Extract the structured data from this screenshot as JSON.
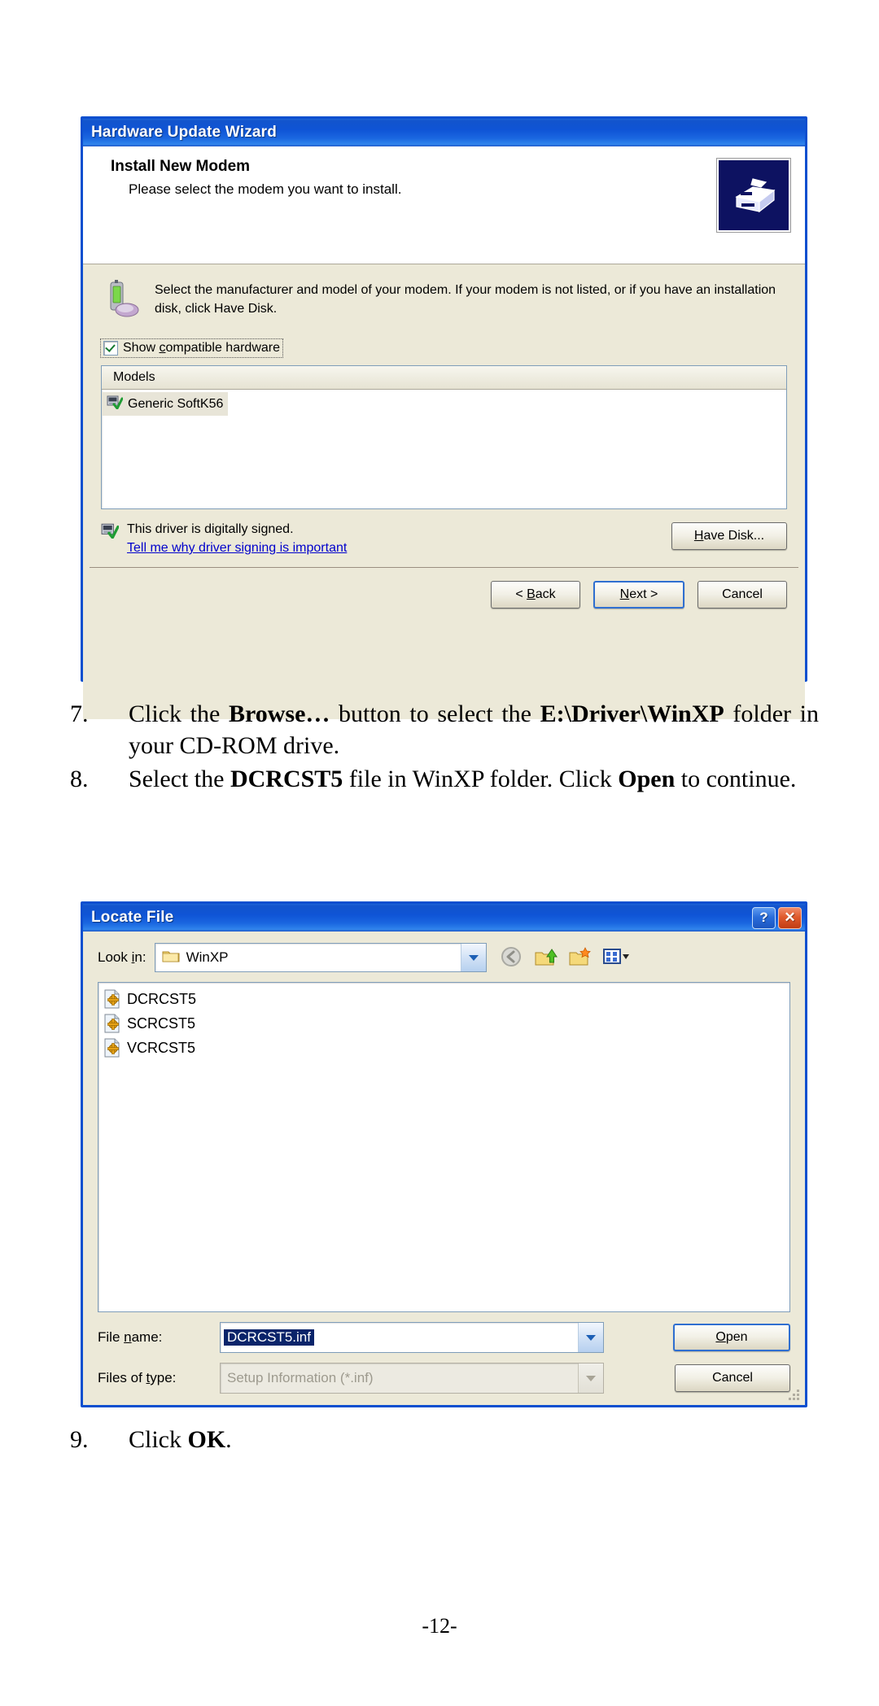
{
  "document": {
    "page_number": "-12-"
  },
  "wizard_dialog": {
    "title": "Hardware Update Wizard",
    "heading": "Install New Modem",
    "subheading": "Please select the modem you want to install.",
    "instruction": "Select the manufacturer and model of your modem. If your modem is not listed, or if you have an installation disk, click Have Disk.",
    "show_compatible_prefix": "Show ",
    "show_compatible_mnemonic": "c",
    "show_compatible_suffix": "ompatible hardware",
    "show_compatible_label": "Show compatible hardware",
    "models_column_header": "Models",
    "models": [
      {
        "name": "Generic SoftK56",
        "selected": true
      }
    ],
    "signed_text": "This driver is digitally signed.",
    "signing_link": "Tell me why driver signing is important",
    "have_disk_label": "Have Disk...",
    "have_disk_mnemonic": "H",
    "buttons": [
      {
        "label": "< Back",
        "mnemonic": "B",
        "default": false
      },
      {
        "label": "Next >",
        "mnemonic": "N",
        "default": true
      },
      {
        "label": "Cancel",
        "mnemonic": "",
        "default": false
      }
    ],
    "back_label": "< Back",
    "next_label": "Next >",
    "cancel_label": "Cancel"
  },
  "steps_top": [
    {
      "number": "7.",
      "html": "Click the <b>Browse&hellip;</b> button to select the <b>E:\\Driver\\WinXP</b> folder in your CD-ROM drive."
    },
    {
      "number": "8.",
      "html": "Select the <b>DCRCST5</b> file in WinXP folder. Click <b>Open</b> to continue."
    }
  ],
  "steps_bottom": [
    {
      "number": "9.",
      "html": "Click <b>OK</b>."
    }
  ],
  "locate_dialog": {
    "title": "Locate File",
    "help_button_label": "?",
    "close_button_label": "✕",
    "lookin_label_prefix": "Look ",
    "lookin_label_mnemonic": "i",
    "lookin_label_suffix": "n:",
    "lookin_label": "Look in:",
    "lookin_value": "WinXP",
    "toolbar_icons": [
      "back-navigation-icon",
      "up-one-level-icon",
      "new-folder-icon",
      "views-icon"
    ],
    "files": [
      {
        "name": "DCRCST5"
      },
      {
        "name": "SCRCST5"
      },
      {
        "name": "VCRCST5"
      }
    ],
    "filename_label_prefix": "File ",
    "filename_label_mnemonic": "n",
    "filename_label_suffix": "ame:",
    "filename_label": "File name:",
    "filename_value": "DCRCST5.inf",
    "filetype_label_prefix": "Files of ",
    "filetype_label_mnemonic": "t",
    "filetype_label_suffix": "ype:",
    "filetype_label": "Files of type:",
    "filetype_value": "Setup Information (*.inf)",
    "open_label": "Open",
    "open_mnemonic": "O",
    "cancel_label": "Cancel"
  },
  "colors": {
    "titlebar_blue": "#0f54d6",
    "dialog_face": "#ece9d8",
    "dialog_border": "#0a4fcf",
    "selection_blue": "#0a246a",
    "link_blue": "#0000cc",
    "close_red": "#e05a2c"
  }
}
